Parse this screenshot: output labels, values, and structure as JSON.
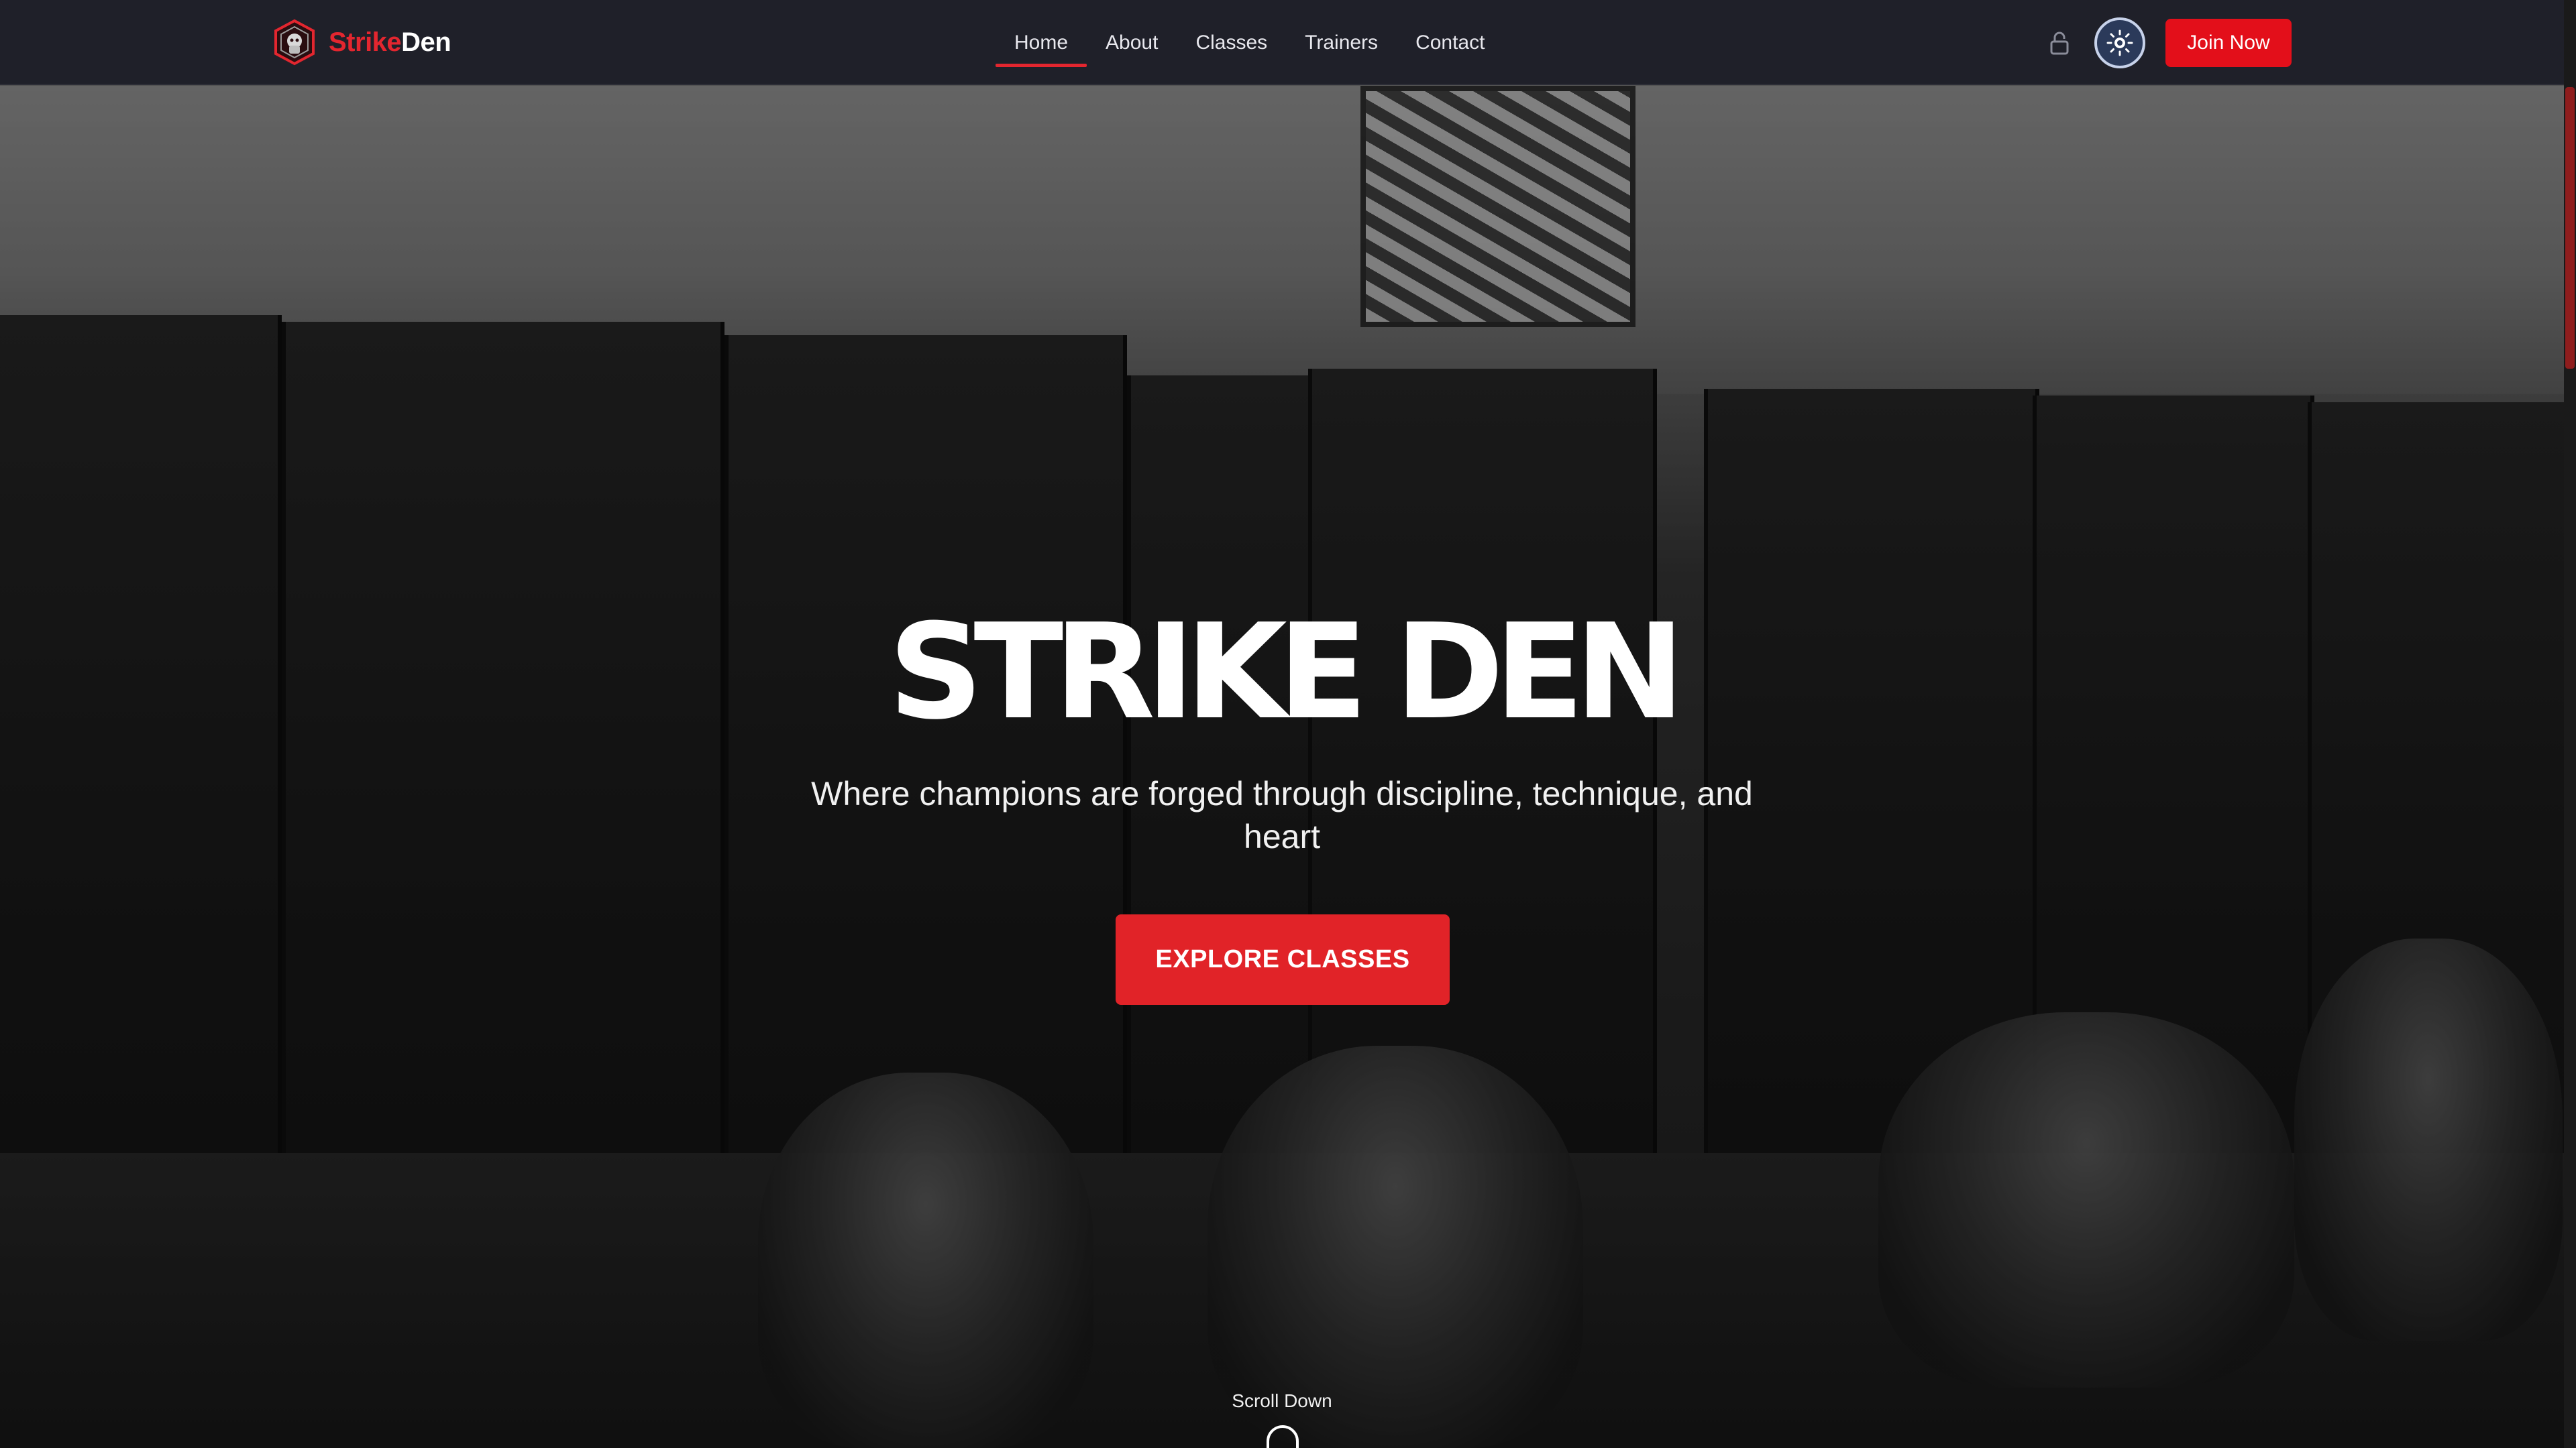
{
  "brand": {
    "part1": "Strike",
    "part2": "Den"
  },
  "nav": {
    "items": [
      {
        "label": "Home",
        "active": true
      },
      {
        "label": "About",
        "active": false
      },
      {
        "label": "Classes",
        "active": false
      },
      {
        "label": "Trainers",
        "active": false
      },
      {
        "label": "Contact",
        "active": false
      }
    ],
    "join_label": "Join Now"
  },
  "hero": {
    "title": "STRIKE DEN",
    "tagline": "Where champions are forged through discipline, technique, and heart",
    "cta_label": "EXPLORE CLASSES",
    "scroll_label": "Scroll Down"
  },
  "icons": {
    "logo": "fist-shield-icon",
    "lock": "lock-icon",
    "theme": "sun-icon",
    "scroll": "mouse-icon"
  },
  "colors": {
    "accent": "#e3262f",
    "navbar_bg": "#1f2029",
    "button_red": "#e30f1a"
  }
}
